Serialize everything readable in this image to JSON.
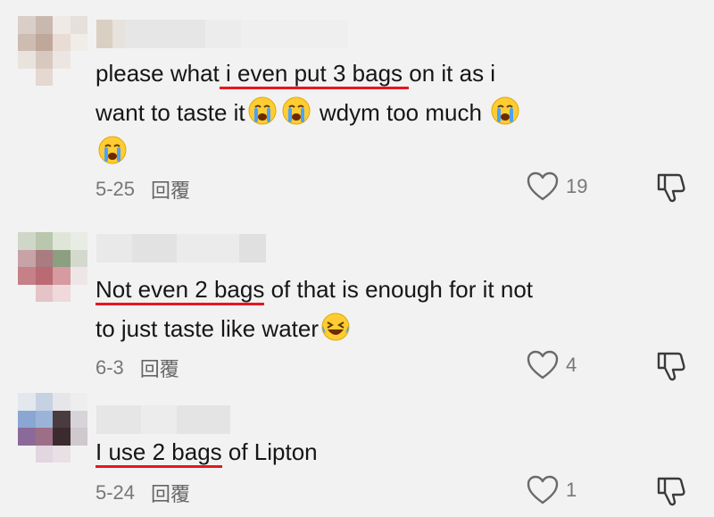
{
  "comments": [
    {
      "text_before": "please what",
      "underlined": " i even put 3 bags ",
      "text_after": "on it as i\nwant to taste it",
      "text_tail": " wdym too much",
      "date": "5-25",
      "reply_label": "回覆",
      "likes": "19"
    },
    {
      "underlined": "Not even 2 bags",
      "text_after": " of that is enough for it not\nto just taste like water",
      "date": "6-3",
      "reply_label": "回覆",
      "likes": "4"
    },
    {
      "underlined": "I use 2 bags",
      "text_after": " of Lipton",
      "date": "5-24",
      "reply_label": "回覆",
      "likes": "1"
    }
  ],
  "colors": {
    "underline": "#e8161f",
    "background": "#f2f2f2",
    "meta": "#777777"
  },
  "icons": [
    "heart-outline-icon",
    "thumbs-down-icon",
    "crying-emoji",
    "laughing-tears-emoji"
  ]
}
